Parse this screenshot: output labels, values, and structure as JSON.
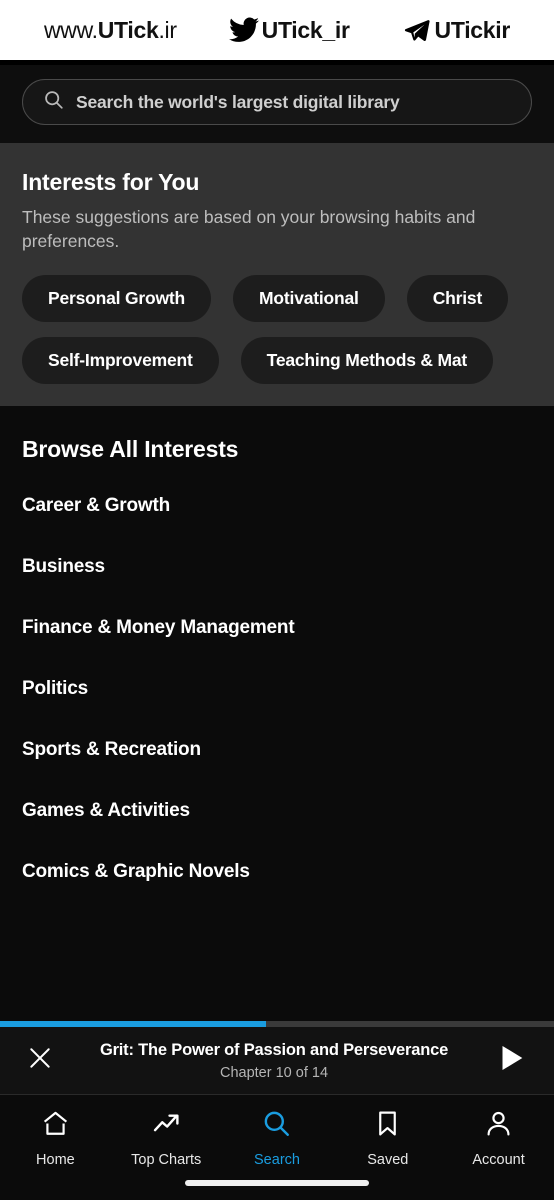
{
  "watermark": {
    "site": {
      "prefix": "www.",
      "name": "UTick",
      "suffix": ".ir"
    },
    "twitter": {
      "icon": "twitter-bird-icon",
      "handle": "UTick_ir"
    },
    "telegram": {
      "icon": "telegram-plane-icon",
      "handle": "UTickir"
    }
  },
  "search": {
    "icon": "search-icon",
    "placeholder": "Search the world's largest digital library",
    "value": ""
  },
  "interests_for_you": {
    "title": "Interests for You",
    "subtitle": "These suggestions are based on your browsing habits and preferences.",
    "chips_row1": [
      "Personal Growth",
      "Motivational",
      "Christ"
    ],
    "chips_row2": [
      "Self-Improvement",
      "Teaching Methods & Mat"
    ]
  },
  "browse_all": {
    "title": "Browse All Interests",
    "items": [
      "Career & Growth",
      "Business",
      "Finance & Money Management",
      "Politics",
      "Sports & Recreation",
      "Games & Activities",
      "Comics & Graphic Novels"
    ]
  },
  "player": {
    "close_icon": "close-icon",
    "title": "Grit: The Power of Passion and Perseverance",
    "chapter": "Chapter 10 of 14",
    "play_icon": "play-icon",
    "progress_percent": 48,
    "progress_color": "#1a9de0"
  },
  "bottom_nav": {
    "active_color": "#1a9de0",
    "items": [
      {
        "label": "Home",
        "icon": "home-icon",
        "active": false
      },
      {
        "label": "Top Charts",
        "icon": "trending-up-icon",
        "active": false
      },
      {
        "label": "Search",
        "icon": "search-icon",
        "active": true
      },
      {
        "label": "Saved",
        "icon": "bookmark-icon",
        "active": false
      },
      {
        "label": "Account",
        "icon": "person-icon",
        "active": false
      }
    ]
  }
}
